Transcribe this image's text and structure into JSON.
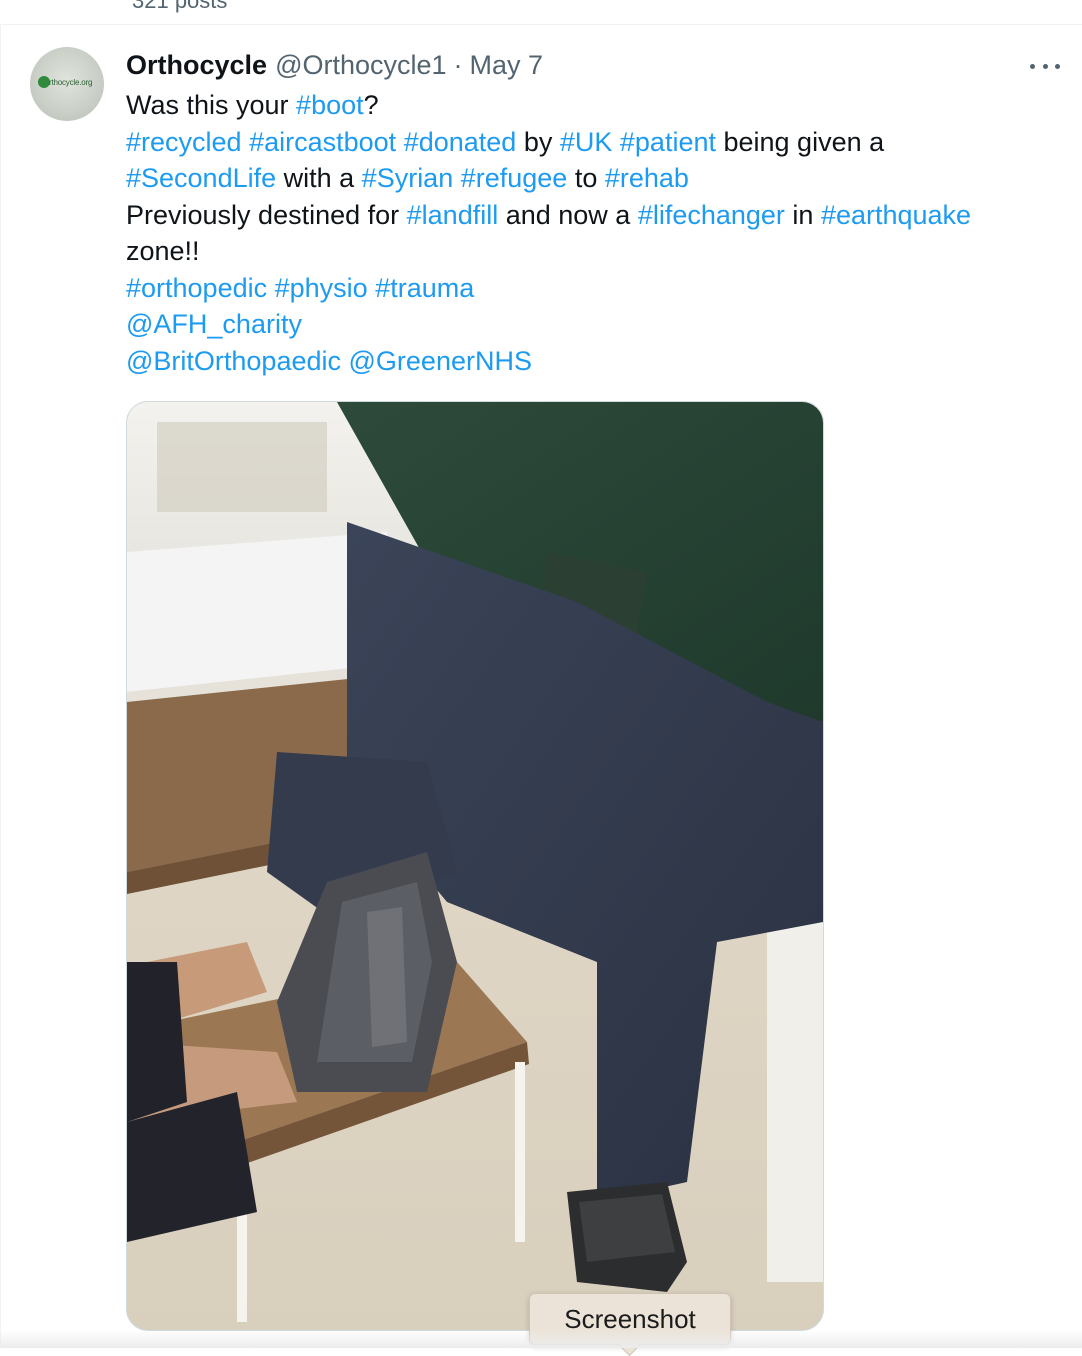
{
  "timeline": {
    "posts_count": "321 posts"
  },
  "tweet": {
    "avatar_text": "Orthocycle.org",
    "display_name": "Orthocycle",
    "handle": "@Orthocycle1",
    "separator": "·",
    "date": "May 7",
    "more_icon": "ellipsis-icon",
    "lines": [
      [
        {
          "t": "Was this your ",
          "k": "text"
        },
        {
          "t": "#boot",
          "k": "tag"
        },
        {
          "t": "?",
          "k": "text"
        }
      ],
      [
        {
          "t": "#recycled",
          "k": "tag"
        },
        {
          "t": " ",
          "k": "text"
        },
        {
          "t": "#aircastboot",
          "k": "tag"
        },
        {
          "t": " ",
          "k": "text"
        },
        {
          "t": "#donated",
          "k": "tag"
        },
        {
          "t": " by ",
          "k": "text"
        },
        {
          "t": "#UK",
          "k": "tag"
        },
        {
          "t": " ",
          "k": "text"
        },
        {
          "t": "#patient",
          "k": "tag"
        },
        {
          "t": " being given a",
          "k": "text"
        }
      ],
      [
        {
          "t": "#SecondLife",
          "k": "tag"
        },
        {
          "t": " with a ",
          "k": "text"
        },
        {
          "t": "#Syrian",
          "k": "tag"
        },
        {
          "t": " ",
          "k": "text"
        },
        {
          "t": "#refugee",
          "k": "tag"
        },
        {
          "t": " to ",
          "k": "text"
        },
        {
          "t": "#rehab",
          "k": "tag"
        }
      ],
      [
        {
          "t": "Previously destined for ",
          "k": "text"
        },
        {
          "t": "#landfill",
          "k": "tag"
        },
        {
          "t": " and now a ",
          "k": "text"
        },
        {
          "t": "#lifechanger",
          "k": "tag"
        },
        {
          "t": " in ",
          "k": "text"
        },
        {
          "t": "#earthquake",
          "k": "tag"
        }
      ],
      [
        {
          "t": "zone!!",
          "k": "text"
        }
      ],
      [
        {
          "t": "#orthopedic",
          "k": "tag"
        },
        {
          "t": " ",
          "k": "text"
        },
        {
          "t": "#physio",
          "k": "tag"
        },
        {
          "t": " ",
          "k": "text"
        },
        {
          "t": "#trauma",
          "k": "tag"
        }
      ],
      [
        {
          "t": "@AFH_charity",
          "k": "tag"
        }
      ],
      [
        {
          "t": "@BritOrthopaedic",
          "k": "tag"
        },
        {
          "t": " ",
          "k": "text"
        },
        {
          "t": "@GreenerNHS",
          "k": "tag"
        }
      ]
    ],
    "link_color": "#1d9bf0"
  },
  "tooltip": {
    "label": "Screenshot"
  }
}
